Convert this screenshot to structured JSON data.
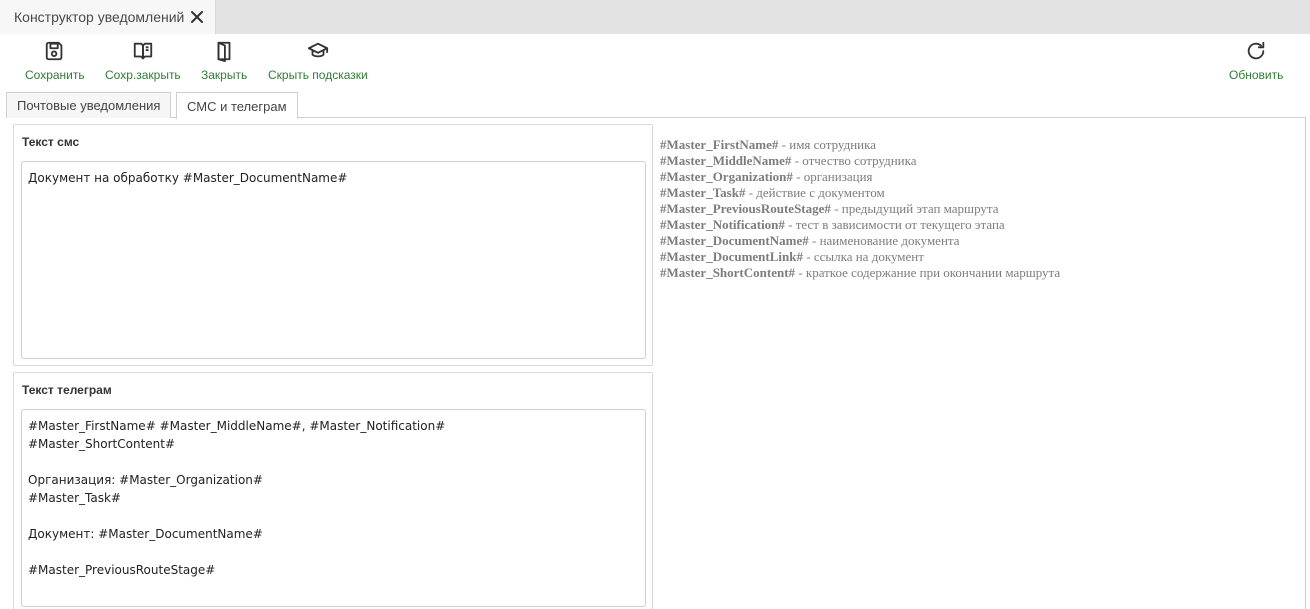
{
  "window": {
    "tab_title": "Конструктор уведомлений",
    "close_icon": "close-icon"
  },
  "toolbar": {
    "save": {
      "label": "Сохранить",
      "icon": "save-icon"
    },
    "save_close": {
      "label": "Сохр.закрыть",
      "icon": "book-open-icon"
    },
    "close": {
      "label": "Закрыть",
      "icon": "door-icon"
    },
    "hide_hints": {
      "label": "Скрыть подсказки",
      "icon": "graduation-cap-icon"
    },
    "refresh": {
      "label": "Обновить",
      "icon": "refresh-icon"
    },
    "accent_color": "#2f7d34"
  },
  "subtabs": [
    {
      "label": "Почтовые уведомления",
      "active": false
    },
    {
      "label": "СМС и телеграм",
      "active": true
    }
  ],
  "sms": {
    "title": "Текст смс",
    "value": "Документ на обработку #Master_DocumentName#"
  },
  "telegram": {
    "title": "Текст телеграм",
    "value": "#Master_FirstName# #Master_MiddleName#, #Master_Notification#\n#Master_ShortContent#\n\nОрганизация: #Master_Organization#\n#Master_Task#\n\nДокумент: #Master_DocumentName#\n\n#Master_PreviousRouteStage#"
  },
  "hints": [
    {
      "key": "#Master_FirstName#",
      "desc": " - имя сотрудника"
    },
    {
      "key": "#Master_MiddleName#",
      "desc": " - отчество сотрудника"
    },
    {
      "key": "#Master_Organization#",
      "desc": " - организация"
    },
    {
      "key": "#Master_Task#",
      "desc": " - действие с документом"
    },
    {
      "key": "#Master_PreviousRouteStage#",
      "desc": " - предыдущий этап маршрута"
    },
    {
      "key": "#Master_Notification#",
      "desc": " - тест в зависимости от текущего этапа"
    },
    {
      "key": "#Master_DocumentName#",
      "desc": " - наименование документа"
    },
    {
      "key": "#Master_DocumentLink#",
      "desc": " - ссылка на документ"
    },
    {
      "key": "#Master_ShortContent#",
      "desc": " - краткое содержание при окончании маршрута"
    }
  ]
}
